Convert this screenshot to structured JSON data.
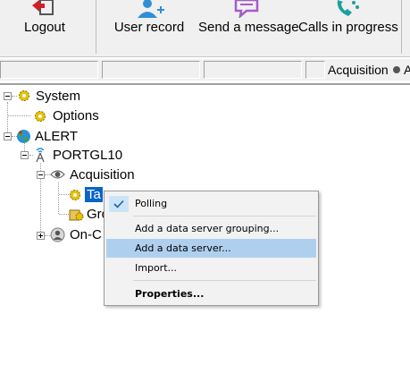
{
  "toolbar": {
    "logout_label": "Logout",
    "user_record_label": "User record",
    "send_message_label": "Send a message",
    "calls_label": "Calls in progress"
  },
  "status": {
    "text": "Acquisition",
    "truncated": "A"
  },
  "tree": {
    "system": "System",
    "options": "Options",
    "alert": "ALERT",
    "portgl10": "PORTGL10",
    "acquisition": "Acquisition",
    "tasks_visible": "Ta",
    "groups_visible": "Gro",
    "oncall_visible": "On-C"
  },
  "menu": {
    "polling": "Polling",
    "add_grouping": "Add a data server grouping...",
    "add_server": "Add a data server...",
    "import": "Import...",
    "properties": "Properties..."
  },
  "colors": {
    "selection": "#0a64c8",
    "menu_highlight": "#aed0ee",
    "icon_blue": "#2e8fd6",
    "icon_purple": "#a35dc8",
    "icon_teal": "#1aa0a0",
    "logout_red": "#d0202a"
  }
}
